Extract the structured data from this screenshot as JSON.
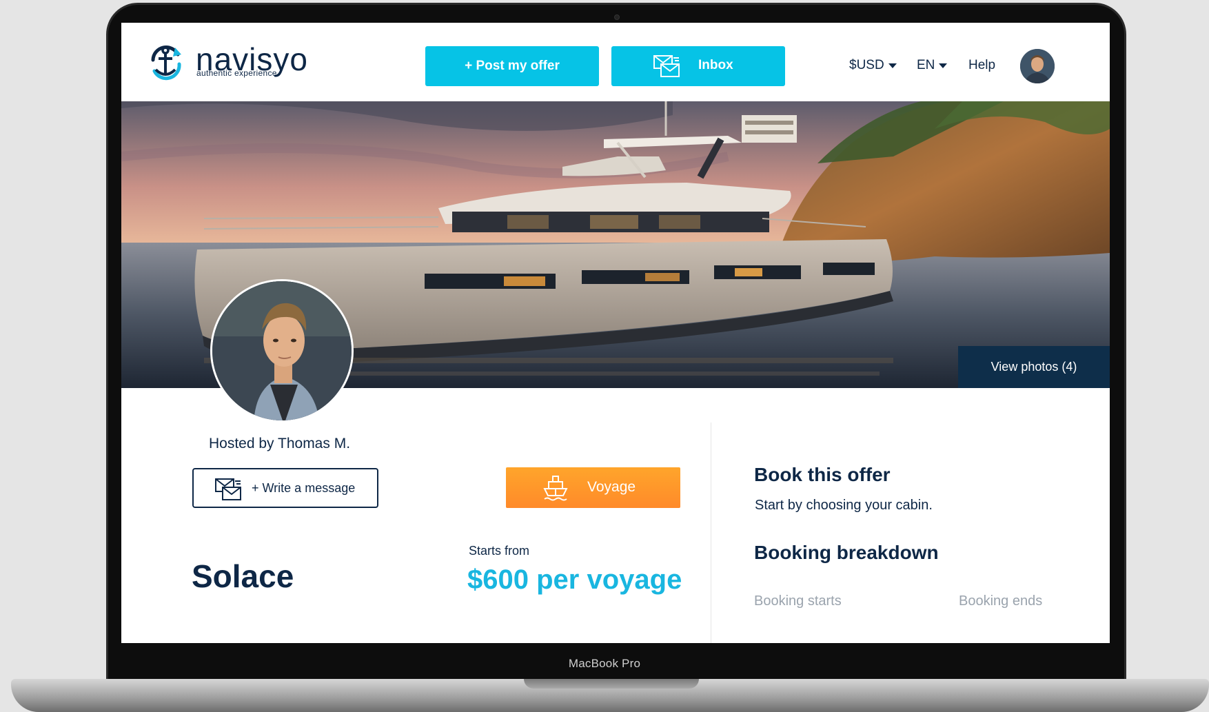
{
  "device": {
    "label": "MacBook Pro"
  },
  "header": {
    "logo_text": "navisyo",
    "logo_tagline": "authentic experience",
    "post_offer_label": "+ Post my offer",
    "inbox_label": "Inbox",
    "currency": "$USD",
    "language": "EN",
    "help": "Help"
  },
  "hero": {
    "view_photos_label": "View photos (4)"
  },
  "host": {
    "hosted_by": "Hosted by Thomas M.",
    "write_message_label": "+ Write a message"
  },
  "offer": {
    "category_label": "Voyage",
    "title": "Solace",
    "starts_from_label": "Starts from",
    "price": "$600 per voyage"
  },
  "booking": {
    "title": "Book this offer",
    "subtitle": "Start by choosing your cabin.",
    "breakdown_title": "Booking breakdown",
    "starts_label": "Booking starts",
    "ends_label": "Booking ends"
  },
  "colors": {
    "brand_cyan": "#06c3e6",
    "navy": "#0e2746",
    "accent_orange": "#ff9a2b",
    "price_blue": "#19b6e0"
  }
}
